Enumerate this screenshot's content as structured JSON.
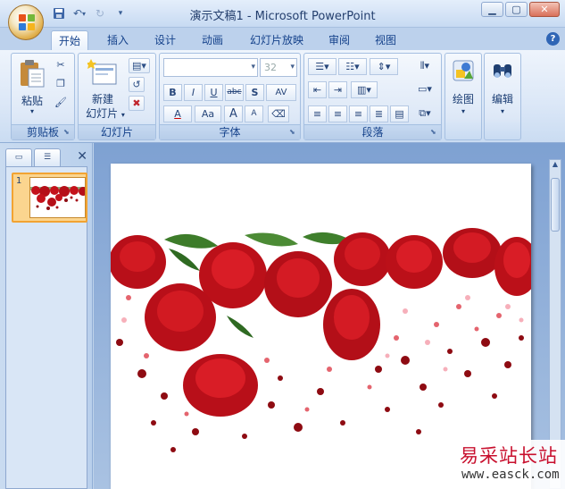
{
  "window": {
    "title": "演示文稿1 - Microsoft PowerPoint"
  },
  "qat": {
    "undo_arrow": "▾",
    "more": "▾"
  },
  "tabs": [
    {
      "label": "开始"
    },
    {
      "label": "插入"
    },
    {
      "label": "设计"
    },
    {
      "label": "动画"
    },
    {
      "label": "幻灯片放映"
    },
    {
      "label": "审阅"
    },
    {
      "label": "视图"
    }
  ],
  "ribbon": {
    "clipboard": {
      "paste_label": "粘贴",
      "group_label": "剪贴板"
    },
    "slides": {
      "new_slide_line1": "新建",
      "new_slide_line2": "幻灯片",
      "group_label": "幻灯片"
    },
    "font": {
      "font_name": "",
      "font_size": "32",
      "group_label": "字体",
      "bold": "B",
      "italic": "I",
      "underline": "U",
      "strike": "abc",
      "shadow": "S",
      "spacing": "AV",
      "color": "A",
      "case": "Aa",
      "grow": "A",
      "shrink": "A"
    },
    "paragraph": {
      "group_label": "段落"
    },
    "drawing": {
      "label": "绘图"
    },
    "editing": {
      "label": "编辑"
    }
  },
  "pane": {
    "slide_number": "1"
  },
  "colors": {
    "accent_orange": "#f2a332",
    "ribbon_text": "#15428b",
    "rose_red": "#c4121b"
  },
  "watermark": {
    "title": "易采站长站",
    "url": "www.easck.com"
  }
}
